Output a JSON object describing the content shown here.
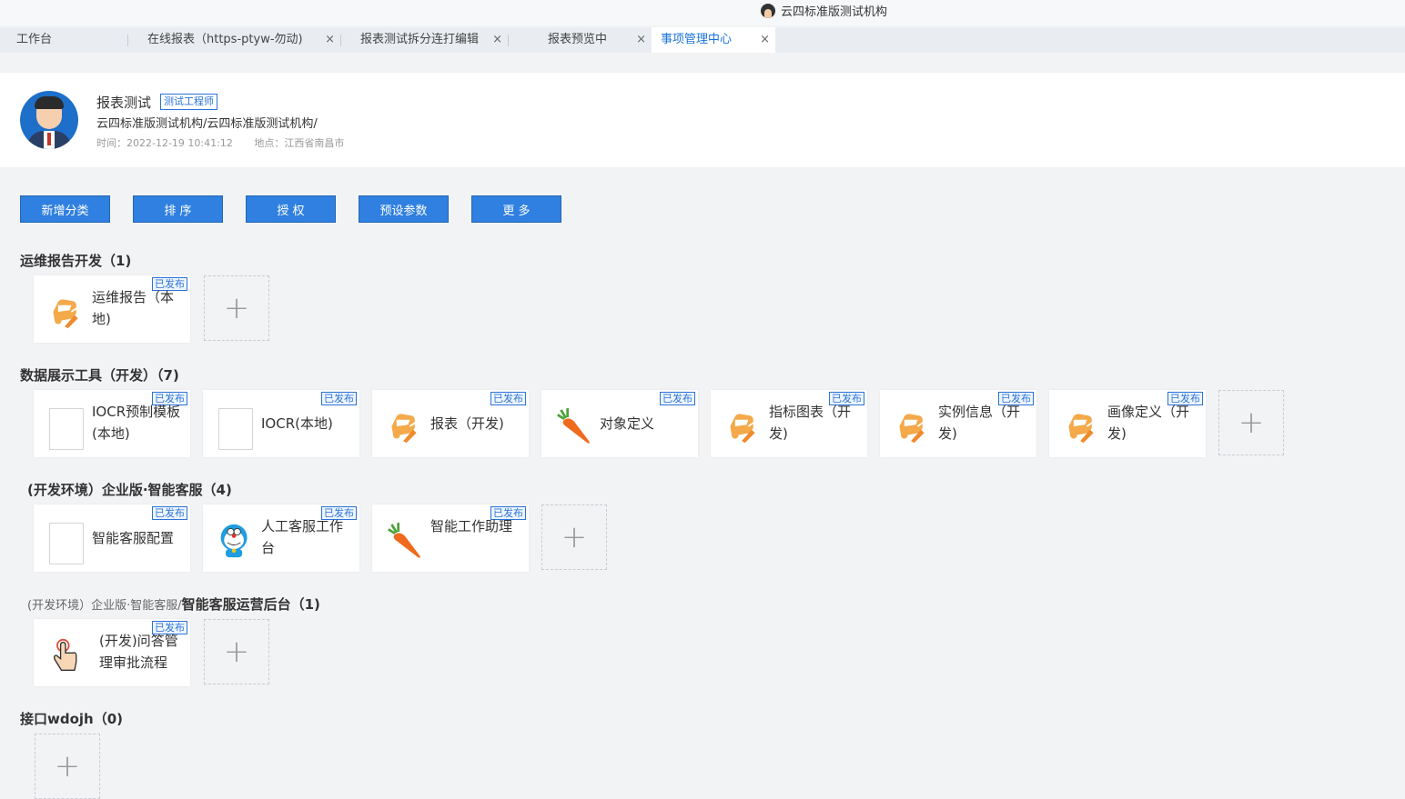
{
  "org": {
    "name": "云四标准版测试机构"
  },
  "tabs": [
    {
      "label": "工作台",
      "closable": false
    },
    {
      "label": "在线报表（https-ptyw-勿动)",
      "closable": true
    },
    {
      "label": "报表测试拆分连打编辑",
      "closable": true
    },
    {
      "label": "报表预览中",
      "closable": true
    },
    {
      "label": "事项管理中心",
      "closable": true,
      "active": true
    }
  ],
  "user": {
    "name": "报表测试",
    "role": "测试工程师",
    "path": "云四标准版测试机构/云四标准版测试机构/",
    "time": "时间：2022-12-19 10:41:12",
    "location": "地点：江西省南昌市"
  },
  "toolbar": {
    "add_category": "新增分类",
    "sort": "排 序",
    "authorize": "授 权",
    "preset_params": "预设参数",
    "more": "更 多"
  },
  "badge": "已发布",
  "add_symbol": "+",
  "sections": [
    {
      "title": "运维报告开发（1)",
      "items": [
        {
          "label": "运维报告（本地)",
          "icon": "car-icon"
        }
      ]
    },
    {
      "title": "数据展示工具（开发）（7)",
      "items": [
        {
          "label": "IOCR预制模板(本地)",
          "icon": "blank-icon"
        },
        {
          "label": "IOCR(本地)",
          "icon": "blank-icon"
        },
        {
          "label": "报表（开发)",
          "icon": "car-icon"
        },
        {
          "label": "对象定义",
          "icon": "carrot-icon"
        },
        {
          "label": "指标图表（开发)",
          "icon": "car-icon"
        },
        {
          "label": "实例信息（开发)",
          "icon": "car-icon"
        },
        {
          "label": "画像定义（开发)",
          "icon": "car-icon"
        }
      ]
    },
    {
      "title": "(开发环境）企业版·智能客服（4)",
      "items": [
        {
          "label": "智能客服配置",
          "icon": "blank-icon"
        },
        {
          "label": "人工客服工作台",
          "icon": "doraemon-icon"
        },
        {
          "label": "智能工作助理",
          "icon": "carrot-icon"
        }
      ]
    },
    {
      "title_prefix": "(开发环境）企业版·智能客服/",
      "title": "智能客服运营后台（1)",
      "items": [
        {
          "label": "(开发)问答管理审批流程",
          "icon": "hand-pointer-icon"
        }
      ]
    },
    {
      "title": "接口wdojh（0)",
      "items": []
    }
  ],
  "colors": {
    "accent": "#2f80e0",
    "badge": "#2b73d6",
    "tab_active": "#1a73d9"
  }
}
